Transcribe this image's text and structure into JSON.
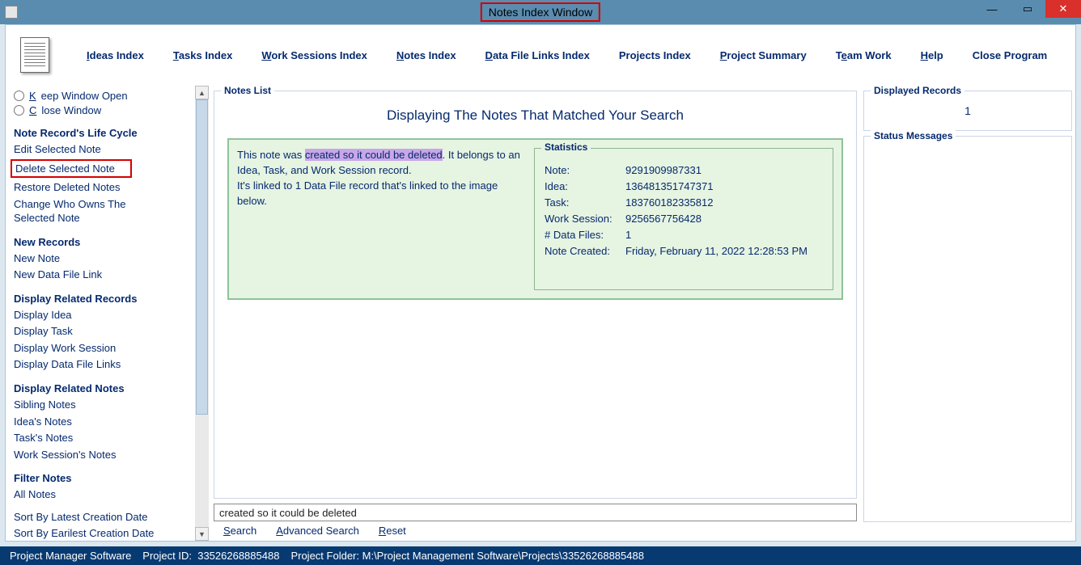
{
  "window": {
    "title": "Notes Index Window"
  },
  "menu": {
    "ideas": "Ideas Index",
    "tasks": "Tasks Index",
    "work_sessions": "Work Sessions Index",
    "notes": "Notes Index",
    "data_file": "Data File Links Index",
    "projects": "Projects Index",
    "summary": "Project Summary",
    "team": "Team Work",
    "help": "Help",
    "close": "Close Program"
  },
  "sidebar": {
    "radio1": "Keep Window Open",
    "radio2": "Close Window",
    "sec_lifecycle": "Note Record's Life Cycle",
    "edit": "Edit Selected Note",
    "delete": "Delete Selected Note",
    "restore": "Restore Deleted Notes",
    "change_owner": "Change Who Owns The Selected Note",
    "sec_new": "New Records",
    "new_note": "New Note",
    "new_link": "New Data File Link",
    "sec_related": "Display Related Records",
    "disp_idea": "Display Idea",
    "disp_task": "Display Task",
    "disp_ws": "Display Work Session",
    "disp_dfl": "Display Data File Links",
    "sec_related_notes": "Display Related Notes",
    "sibling": "Sibling Notes",
    "idea_notes": "Idea's Notes",
    "task_notes": "Task's Notes",
    "ws_notes": "Work Session's Notes",
    "sec_filter": "Filter Notes",
    "all_notes": "All Notes",
    "sort_latest": "Sort By Latest Creation Date",
    "sort_earliest": "Sort By Earilest Creation Date"
  },
  "notes_list": {
    "legend": "Notes List",
    "heading": "Displaying The Notes That Matched Your Search",
    "note": {
      "pre": "This note was ",
      "highlight": "created so it could be deleted",
      "post1": ". It belongs to an Idea, Task, and Work Session record.",
      "post2": "It's linked to 1 Data File record that's linked to the image below."
    },
    "stats": {
      "legend": "Statistics",
      "note_k": "Note:",
      "note_v": "9291909987331",
      "idea_k": "Idea:",
      "idea_v": "136481351747371",
      "task_k": "Task:",
      "task_v": "183760182335812",
      "ws_k": "Work Session:",
      "ws_v": "9256567756428",
      "df_k": "# Data Files:",
      "df_v": "1",
      "created_k": "Note Created:",
      "created_v": "Friday, February 11, 2022   12:28:53 PM"
    }
  },
  "search": {
    "value": "created so it could be deleted",
    "search": "Search",
    "advanced": "Advanced Search",
    "reset": "Reset"
  },
  "right": {
    "records_legend": "Displayed Records",
    "records_count": "1",
    "status_legend": "Status Messages"
  },
  "statusbar": {
    "app": "Project Manager Software",
    "pid_label": "Project ID:",
    "pid": "33526268885488",
    "folder_label": "Project Folder:",
    "folder": "M:\\Project Management Software\\Projects\\33526268885488"
  }
}
